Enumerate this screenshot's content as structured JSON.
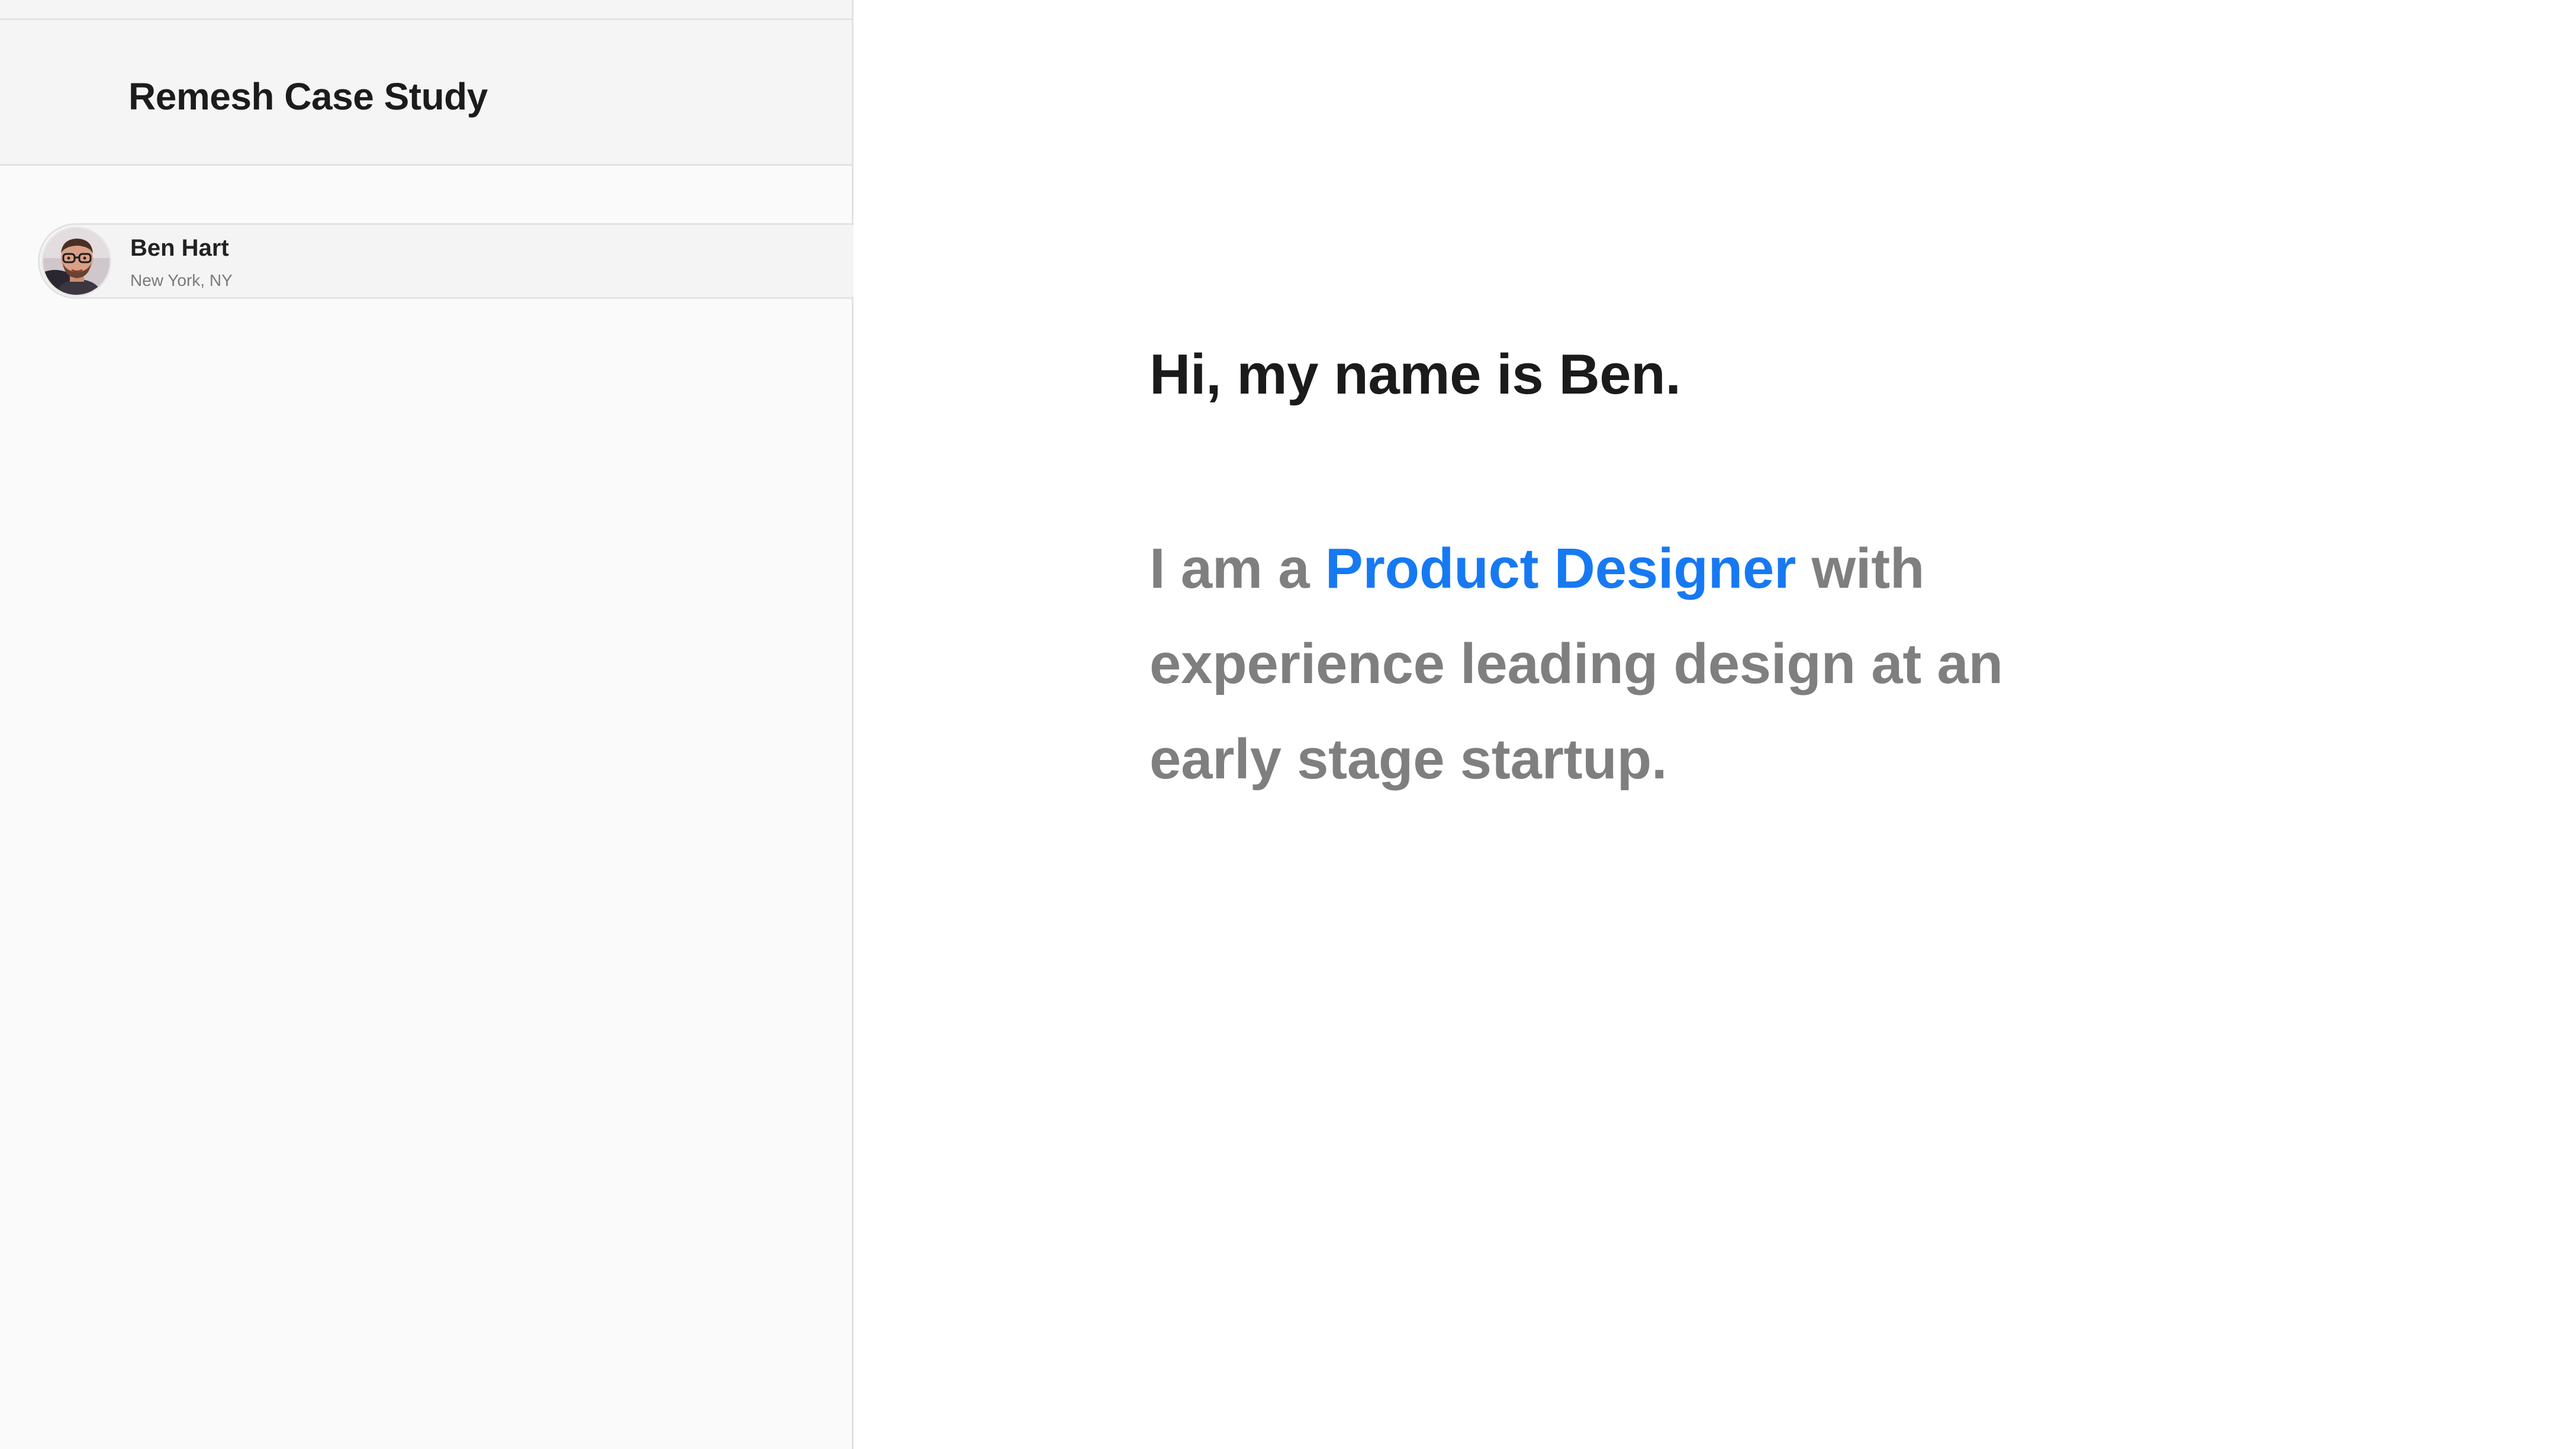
{
  "sidebar": {
    "title": "Remesh Case Study",
    "profile": {
      "name": "Ben Hart",
      "location": "New York, NY",
      "avatar_icon": "person-avatar-photo"
    }
  },
  "main": {
    "greeting": "Hi, my name is Ben.",
    "intro": {
      "prefix": "I am a ",
      "highlight": "Product Designer",
      "suffix": " with experience leading design at an early stage startup."
    }
  },
  "colors": {
    "highlight": "#1779f2",
    "body_text": "#7f7f7f",
    "heading_text": "#1b1b1b",
    "sidebar_bg": "#fafafa"
  }
}
